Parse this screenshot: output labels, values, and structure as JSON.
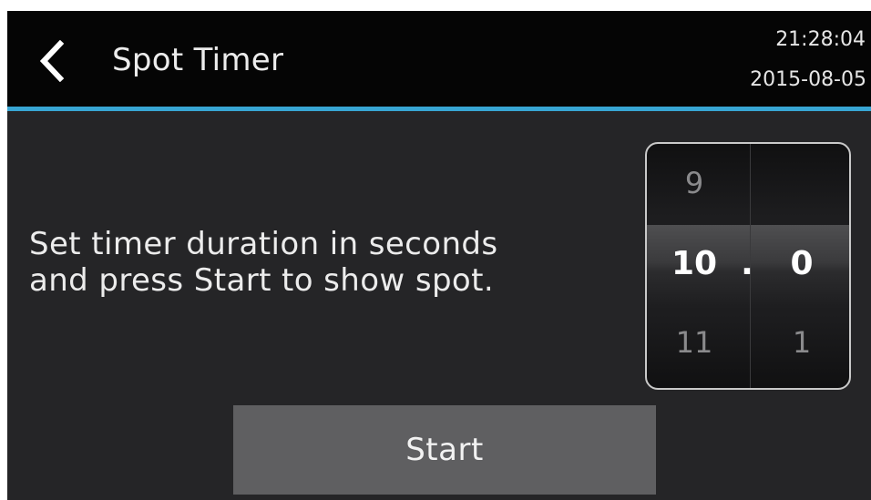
{
  "header": {
    "title": "Spot Timer",
    "time": "21:28:04",
    "date": "2015-08-05",
    "back_icon": "chevron-left-icon",
    "accent_color": "#38a6d4"
  },
  "main": {
    "instruction_line1": "Set timer duration in seconds",
    "instruction_line2": "and press Start to show spot."
  },
  "picker": {
    "integer": {
      "prev": "9",
      "selected": "10",
      "next": "11"
    },
    "separator": ".",
    "decimal": {
      "prev": "",
      "selected": "0",
      "next": "1"
    },
    "value_seconds": 10.0
  },
  "actions": {
    "start_label": "Start"
  }
}
